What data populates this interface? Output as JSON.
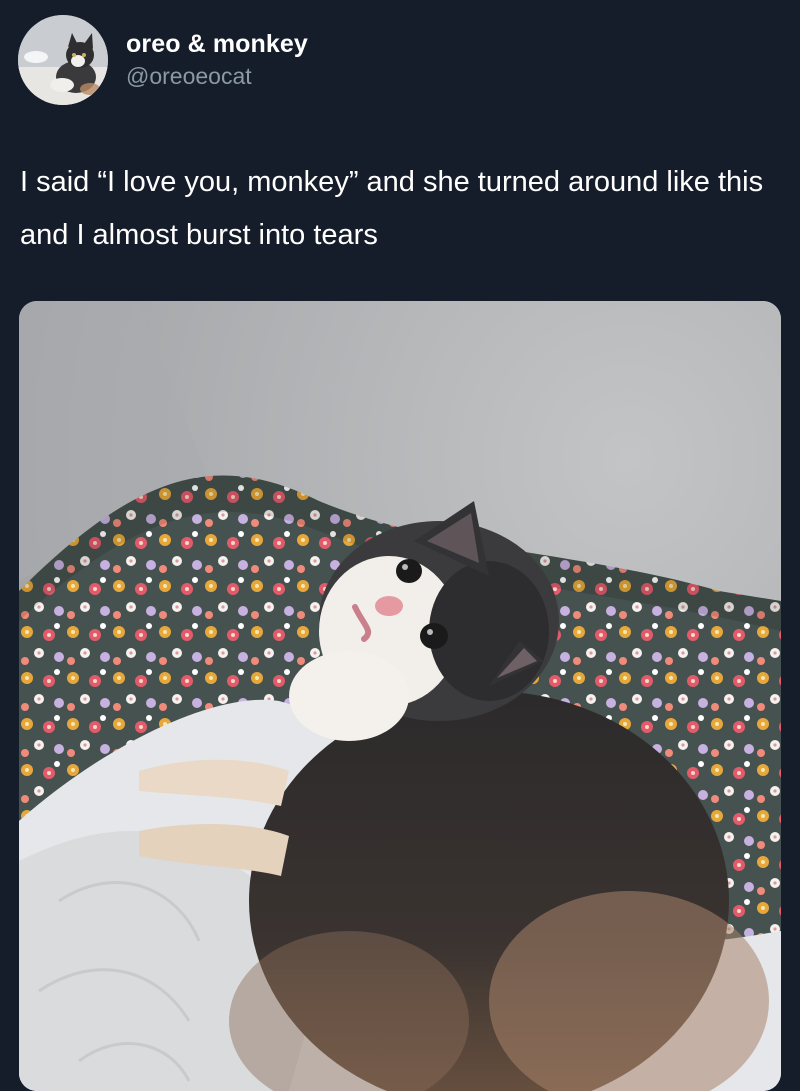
{
  "author": {
    "display_name": "oreo & monkey",
    "handle": "@oreoeocat",
    "avatar_icon": "cat-photo-avatar"
  },
  "tweet": {
    "text": "I said “I love you, monkey” and she turned around like this and I almost burst into tears"
  },
  "media": {
    "type": "photo",
    "icon": "cat-photo"
  },
  "colors": {
    "background": "#161d2a",
    "primary_text": "#ffffff",
    "secondary_text": "#8b98a5"
  }
}
